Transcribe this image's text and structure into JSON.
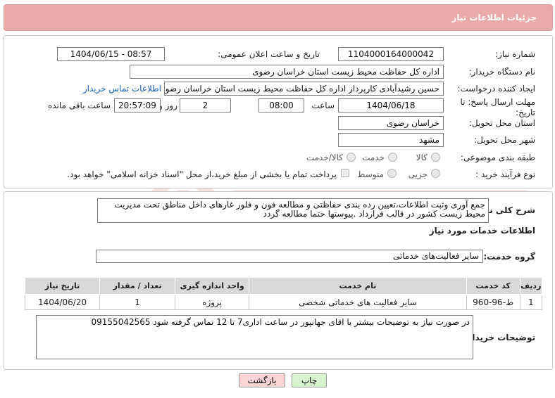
{
  "header": {
    "title": "جزئیات اطلاعات نیاز"
  },
  "form": {
    "need_number_label": "شماره نیاز:",
    "need_number": "1104000164000042",
    "announce_label": "تاریخ و ساعت اعلان عمومی:",
    "announce_value": "1404/06/15 - 08:57",
    "buyer_org_label": "نام دستگاه خریدار:",
    "buyer_org": "اداره کل حفاظت محیط زیست استان خراسان رضوی",
    "requester_label": "ایجاد کننده درخواست:",
    "requester": "حسین رشیدآبادی کارپرداز اداره کل حفاظت محیط زیست استان خراسان رضوی",
    "contact_link": "اطلاعات تماس خریدار",
    "deadline_label_1": "مهلت ارسال پاسخ: تا",
    "deadline_label_2": "تاریخ:",
    "deadline_date": "1404/06/18",
    "time_label": "ساعت",
    "deadline_time": "08:00",
    "days_value": "2",
    "days_label": "روز و",
    "remaining_time": "20:57:09",
    "remaining_label": "ساعت باقی مانده",
    "province_label": "استان محل تحویل:",
    "province": "خراسان رضوی",
    "city_label": "شهر محل تحویل:",
    "city": "مشهد",
    "category_label": "طبقه بندی موضوعی:",
    "category_options": [
      "کالا",
      "خدمت",
      "کالا/خدمت"
    ],
    "process_label": "نوع فرآیند خرید :",
    "process_options": [
      "جزیی",
      "متوسط"
    ],
    "payment_note": "پرداخت تمام یا بخشی از مبلغ خرید،از محل \"اسناد خزانه اسلامی\" خواهد بود."
  },
  "details": {
    "summary_label": "شرح کلی نیاز:",
    "summary_text": "جمع آوری وثبت اطلاعات،تعیین رده بندی حفاظتی و مطالعه فون و فلور غارهای داخل مناطق تحت مدیریت محیط زیست کشور در قالب قرارداد .پیوستها حتما مطالعه گردد",
    "services_title": "اطلاعات خدمات مورد نیاز",
    "group_label": "گروه خدمت:",
    "group_value": "سایر فعالیت‌های خدماتی",
    "table_headers": [
      "ردیف",
      "کد خدمت",
      "نام خدمت",
      "واحد اندازه گیری",
      "تعداد / مقدار",
      "تاریخ نیاز"
    ],
    "table_rows": [
      [
        "1",
        "ط-96-960",
        "سایر فعالیت های خدماتی شخصی",
        "پروژه",
        "1",
        "1404/06/20"
      ]
    ],
    "buyer_notes_label": "توضیحات خریدار:",
    "buyer_notes": "در صورت نیاز به توضیحات بیشتر با اقای جهانپور در ساعت اداری7 تا 12 تماس گرفته شود 09155042565"
  },
  "buttons": {
    "print": "چاپ",
    "back": "بازگشت"
  },
  "colors": {
    "header_bg": "#e8aaaa",
    "print_bg": "#d8f5d0",
    "back_bg": "#fbd5d5",
    "link": "#1a5fb4"
  }
}
